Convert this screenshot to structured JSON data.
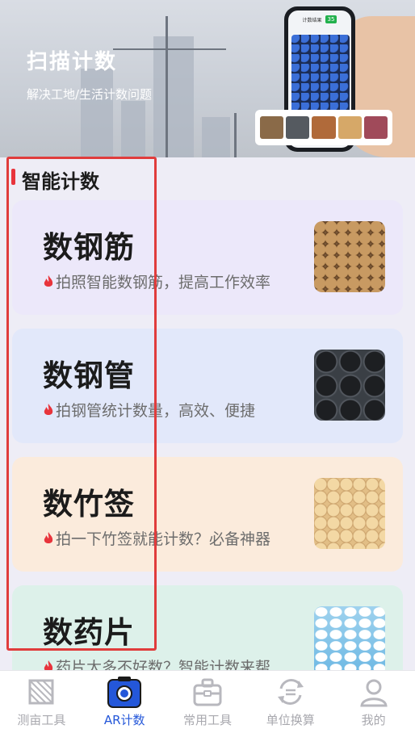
{
  "banner": {
    "title": "扫描计数",
    "subtitle": "解决工地/生活计数问题",
    "phone_header": "计数结果",
    "phone_count": "35"
  },
  "section": {
    "title": "智能计数"
  },
  "cards": [
    {
      "title": "数钢筋",
      "desc": "拍照智能数钢筋，提高工作效率",
      "image": "rebar-photo"
    },
    {
      "title": "数钢管",
      "desc": "拍钢管统计数量，高效、便捷",
      "image": "steel-pipe-photo"
    },
    {
      "title": "数竹签",
      "desc": "拍一下竹签就能计数？必备神器",
      "image": "bamboo-stick-photo"
    },
    {
      "title": "数药片",
      "desc": "药片太多不好数？智能计数来帮",
      "image": "pill-photo"
    }
  ],
  "tabs": [
    {
      "label": "测亩工具",
      "icon": "grid-polygon-icon"
    },
    {
      "label": "AR计数",
      "icon": "camera-icon"
    },
    {
      "label": "常用工具",
      "icon": "toolbox-icon"
    },
    {
      "label": "单位换算",
      "icon": "convert-icon"
    },
    {
      "label": "我的",
      "icon": "user-icon"
    }
  ],
  "colors": {
    "accent": "#2457d9",
    "section_mark": "#e8343c",
    "highlight": "#e03c3c",
    "fire": "#e8343c"
  }
}
